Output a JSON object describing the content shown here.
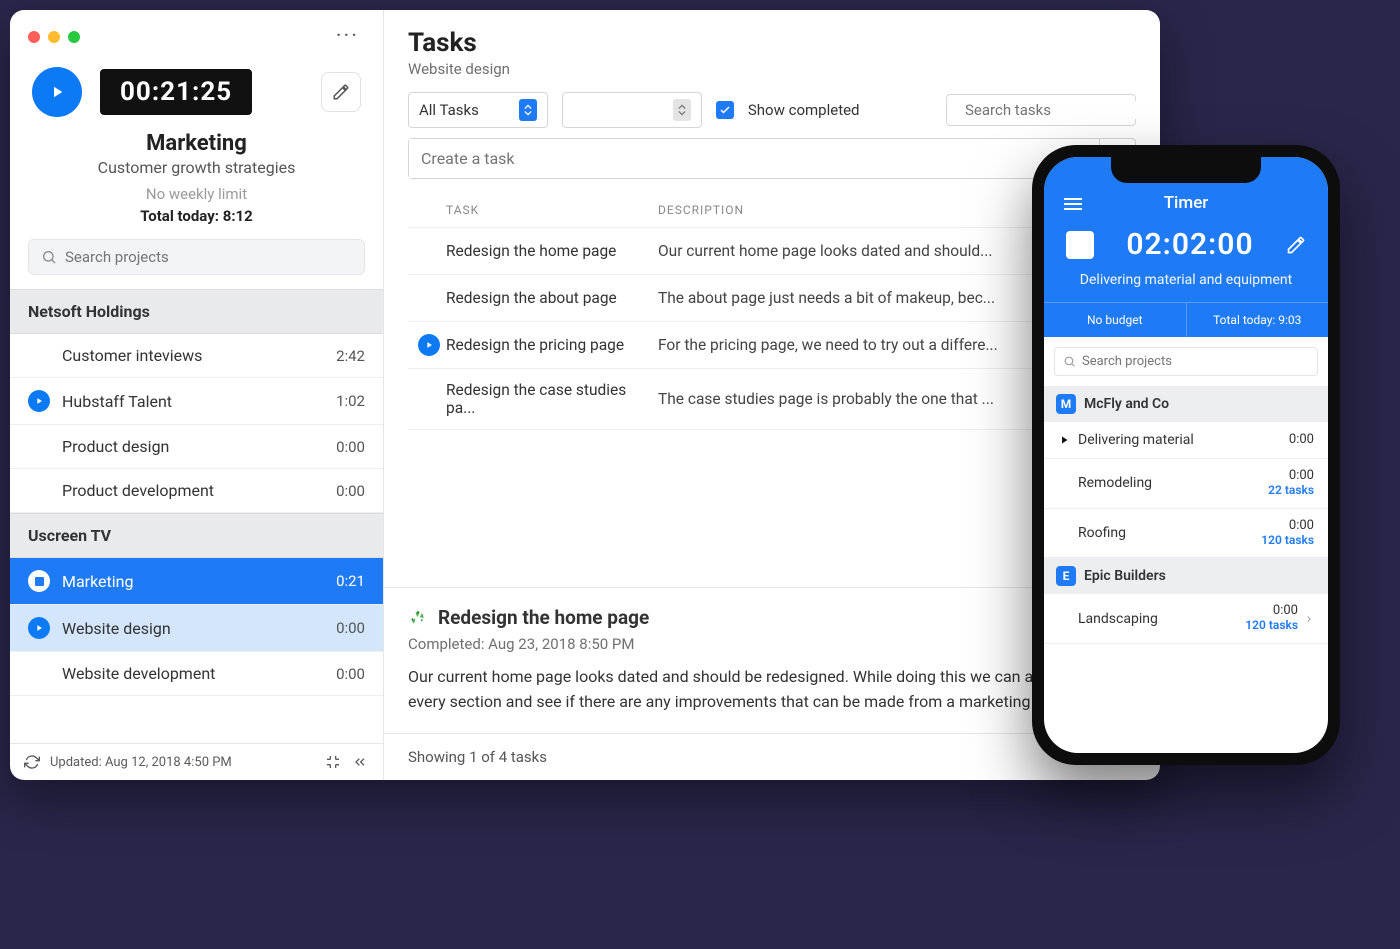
{
  "sidebar": {
    "timer": "00:21:25",
    "project_title": "Marketing",
    "project_subtitle": "Customer growth strategies",
    "weekly_limit": "No weekly limit",
    "total_today": "Total today: 8:12",
    "search_placeholder": "Search projects",
    "groups": [
      {
        "name": "Netsoft Holdings",
        "projects": [
          {
            "name": "Customer inteviews",
            "time": "2:42",
            "icon": "none"
          },
          {
            "name": "Hubstaff Talent",
            "time": "1:02",
            "icon": "play"
          },
          {
            "name": "Product design",
            "time": "0:00",
            "icon": "none"
          },
          {
            "name": "Product development",
            "time": "0:00",
            "icon": "none"
          }
        ]
      },
      {
        "name": "Uscreen TV",
        "projects": [
          {
            "name": "Marketing",
            "time": "0:21",
            "icon": "stop",
            "state": "active"
          },
          {
            "name": "Website design",
            "time": "0:00",
            "icon": "play-outline",
            "state": "active2"
          },
          {
            "name": "Website development",
            "time": "0:00",
            "icon": "none"
          }
        ]
      }
    ],
    "footer_updated": "Updated: Aug 12, 2018 4:50 PM"
  },
  "main": {
    "heading": "Tasks",
    "subheading": "Website design",
    "filter_select": "All Tasks",
    "show_completed_label": "Show completed",
    "search_placeholder": "Search tasks",
    "create_placeholder": "Create a task",
    "col_task": "TASK",
    "col_desc": "DESCRIPTION",
    "rows": [
      {
        "task": "Redesign the home page",
        "desc": "Our current home page looks dated and should..."
      },
      {
        "task": "Redesign the about page",
        "desc": "The about page just needs a bit of makeup, bec..."
      },
      {
        "task": "Redesign the pricing page",
        "desc": "For the pricing page, we need to try out a differe...",
        "selected": true
      },
      {
        "task": "Redesign the case studies pa...",
        "desc": "The case studies page is probably the one that ..."
      }
    ],
    "detail": {
      "title": "Redesign the home page",
      "completed": "Completed: Aug 23, 2018 8:50 PM",
      "body": "Our current home page looks dated and should be redesigned. While doing this we can also look at every section and see if there are any improvements that can be made from a marketing point"
    },
    "showing": "Showing 1 of 4 tasks"
  },
  "phone": {
    "title": "Timer",
    "time": "02:02:00",
    "subtitle": "Delivering material and equipment",
    "no_budget": "No budget",
    "total_today": "Total today: 9:03",
    "search_placeholder": "Search projects",
    "groups": [
      {
        "badge": "M",
        "name": "McFly and Co",
        "projects": [
          {
            "name": "Delivering material",
            "time": "0:00",
            "tasks": "",
            "play": true
          },
          {
            "name": "Remodeling",
            "time": "0:00",
            "tasks": "22 tasks"
          },
          {
            "name": "Roofing",
            "time": "0:00",
            "tasks": "120 tasks"
          }
        ]
      },
      {
        "badge": "E",
        "name": "Epic Builders",
        "projects": [
          {
            "name": "Landscaping",
            "time": "0:00",
            "tasks": "120 tasks",
            "chevron": true
          }
        ]
      }
    ]
  }
}
